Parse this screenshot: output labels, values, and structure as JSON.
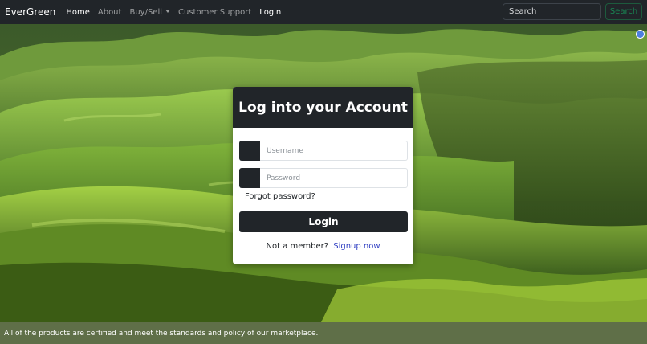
{
  "navbar": {
    "brand": "EverGreen",
    "links": [
      {
        "label": "Home"
      },
      {
        "label": "About"
      },
      {
        "label": "Buy/Sell"
      },
      {
        "label": "Customer Support"
      },
      {
        "label": "Login"
      }
    ],
    "search": {
      "placeholder": "Search",
      "button_label": "Search"
    }
  },
  "login_card": {
    "title": "Log into your Account",
    "username_placeholder": "Username",
    "password_placeholder": "Password",
    "forgot_label": "Forgot password?",
    "login_button": "Login",
    "signup_prompt": "Not a member?",
    "signup_link": "Signup now"
  },
  "footer": {
    "text": "All of the products are certified and meet the standards and policy of our marketplace."
  },
  "colors": {
    "navbar_bg": "#212529",
    "footer_bg": "#5f6f48",
    "search_button": "#198754",
    "signup_link": "#2f3ec2"
  },
  "icons": {
    "chat": "chat-bubble-icon"
  }
}
